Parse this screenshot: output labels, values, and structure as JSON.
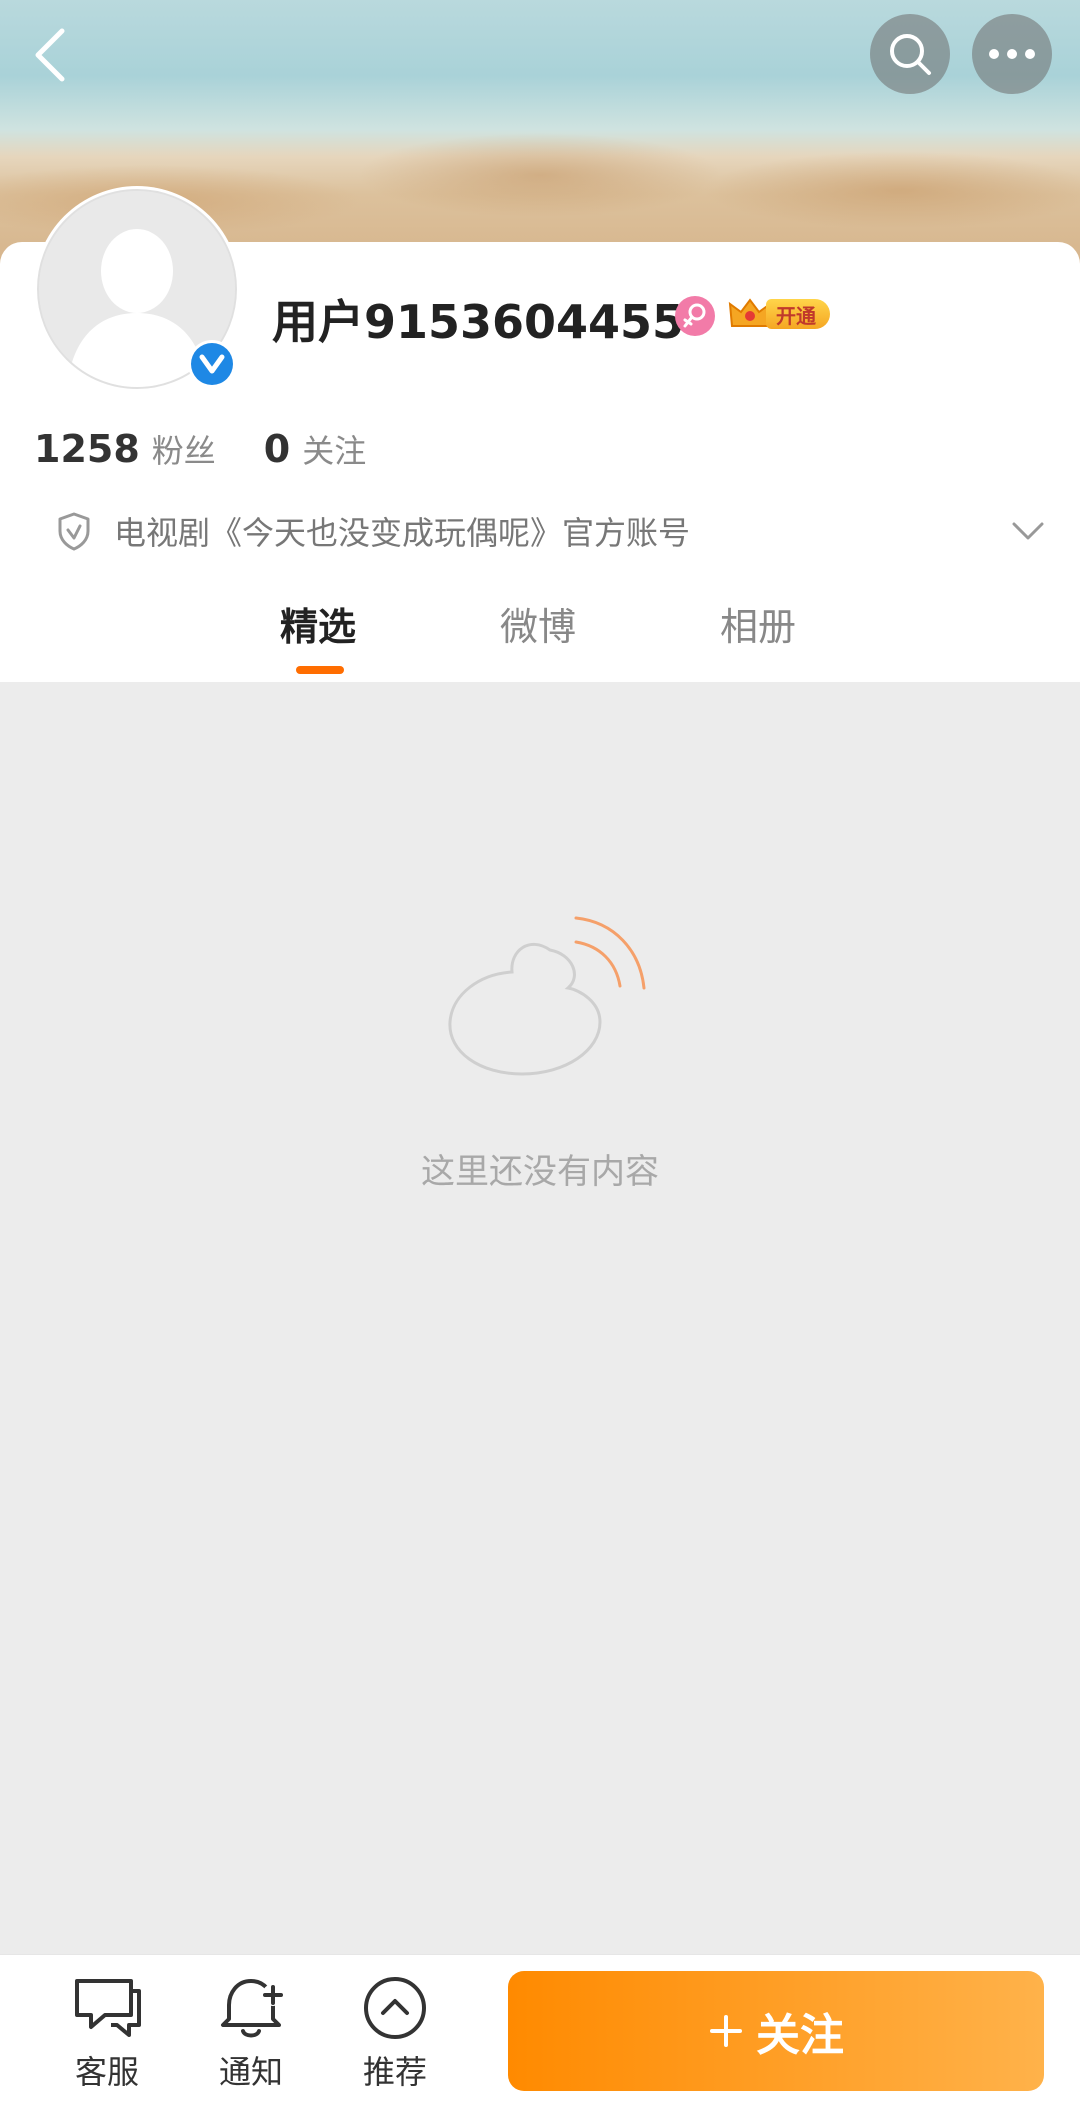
{
  "profile": {
    "username": "用户9153604455",
    "vip_label": "开通",
    "stats": {
      "fans_count": "1258",
      "fans_label": "粉丝",
      "following_count": "0",
      "following_label": "关注"
    },
    "description": "电视剧《今天也没变成玩偶呢》官方账号"
  },
  "tabs": [
    {
      "label": "精选",
      "active": true
    },
    {
      "label": "微博",
      "active": false
    },
    {
      "label": "相册",
      "active": false
    }
  ],
  "empty_state": {
    "message": "这里还没有内容"
  },
  "bottom_bar": {
    "items": [
      {
        "label": "客服",
        "icon": "chat-icon"
      },
      {
        "label": "通知",
        "icon": "bell-plus-icon"
      },
      {
        "label": "推荐",
        "icon": "chevron-up-circle-icon"
      }
    ],
    "follow_label": "关注"
  },
  "colors": {
    "accent_orange": "#ff8a00",
    "verified_blue": "#1e88e5",
    "female_pink": "#f27ba8"
  }
}
